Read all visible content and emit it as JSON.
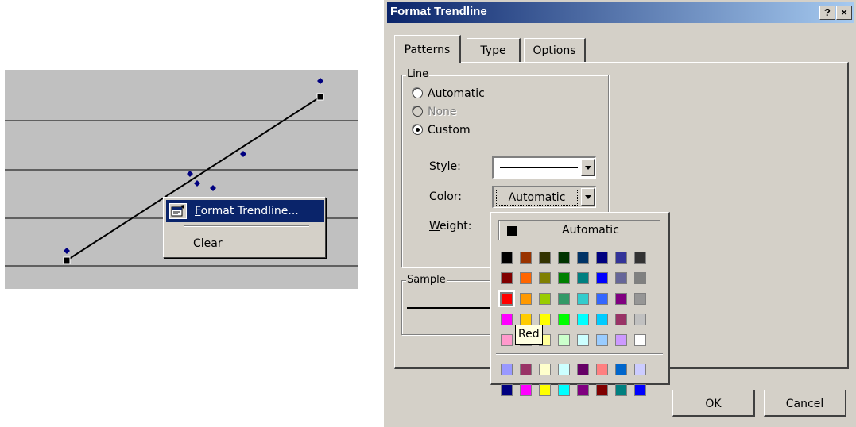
{
  "chart": {
    "context_menu": {
      "items": [
        {
          "label_accel": "F",
          "label_rest": "ormat Trendline..."
        },
        {
          "label_pre": "Cl",
          "label_accel": "e",
          "label_rest": "ar"
        }
      ]
    }
  },
  "dialog": {
    "title": "Format Trendline",
    "help_button": "?",
    "close_button": "×",
    "tabs": [
      "Patterns",
      "Type",
      "Options"
    ],
    "line_group": {
      "legend": "Line",
      "radios": [
        {
          "label_accel": "A",
          "label_rest": "utomatic",
          "selected": false,
          "enabled": true
        },
        {
          "label_accel": "",
          "label_rest": "None",
          "selected": false,
          "enabled": false
        },
        {
          "label_accel": "",
          "label_rest": "Custom",
          "selected": true,
          "enabled": true
        }
      ],
      "style_label_accel": "S",
      "style_label_rest": "tyle:",
      "color_label": "Color:",
      "color_value": "Automatic",
      "weight_label_accel": "W",
      "weight_label_rest": "eight:"
    },
    "sample_group": {
      "legend": "Sample"
    },
    "buttons": {
      "ok": "OK",
      "cancel": "Cancel"
    }
  },
  "palette": {
    "automatic_label": "Automatic",
    "tooltip": "Red",
    "selected": "Red",
    "rows": [
      [
        "#000000",
        "#993300",
        "#333300",
        "#003300",
        "#003366",
        "#000080",
        "#333399",
        "#333333"
      ],
      [
        "#800000",
        "#ff6600",
        "#808000",
        "#008000",
        "#008080",
        "#0000ff",
        "#666699",
        "#808080"
      ],
      [
        "#ff0000",
        "#ff9900",
        "#99cc00",
        "#339966",
        "#33cccc",
        "#3366ff",
        "#800080",
        "#969696"
      ],
      [
        "#ff00ff",
        "#ffcc00",
        "#ffff00",
        "#00ff00",
        "#00ffff",
        "#00ccff",
        "#993366",
        "#c0c0c0"
      ],
      [
        "#ff99cc",
        "#ffcc99",
        "#ffff99",
        "#ccffcc",
        "#ccffff",
        "#99ccff",
        "#cc99ff",
        "#ffffff"
      ]
    ],
    "chart_rows": [
      [
        "#9999ff",
        "#993366",
        "#ffffcc",
        "#ccffff",
        "#660066",
        "#ff8080",
        "#0066cc",
        "#ccccff"
      ],
      [
        "#000080",
        "#ff00ff",
        "#ffff00",
        "#00ffff",
        "#800080",
        "#800000",
        "#008080",
        "#0000ff"
      ]
    ]
  }
}
